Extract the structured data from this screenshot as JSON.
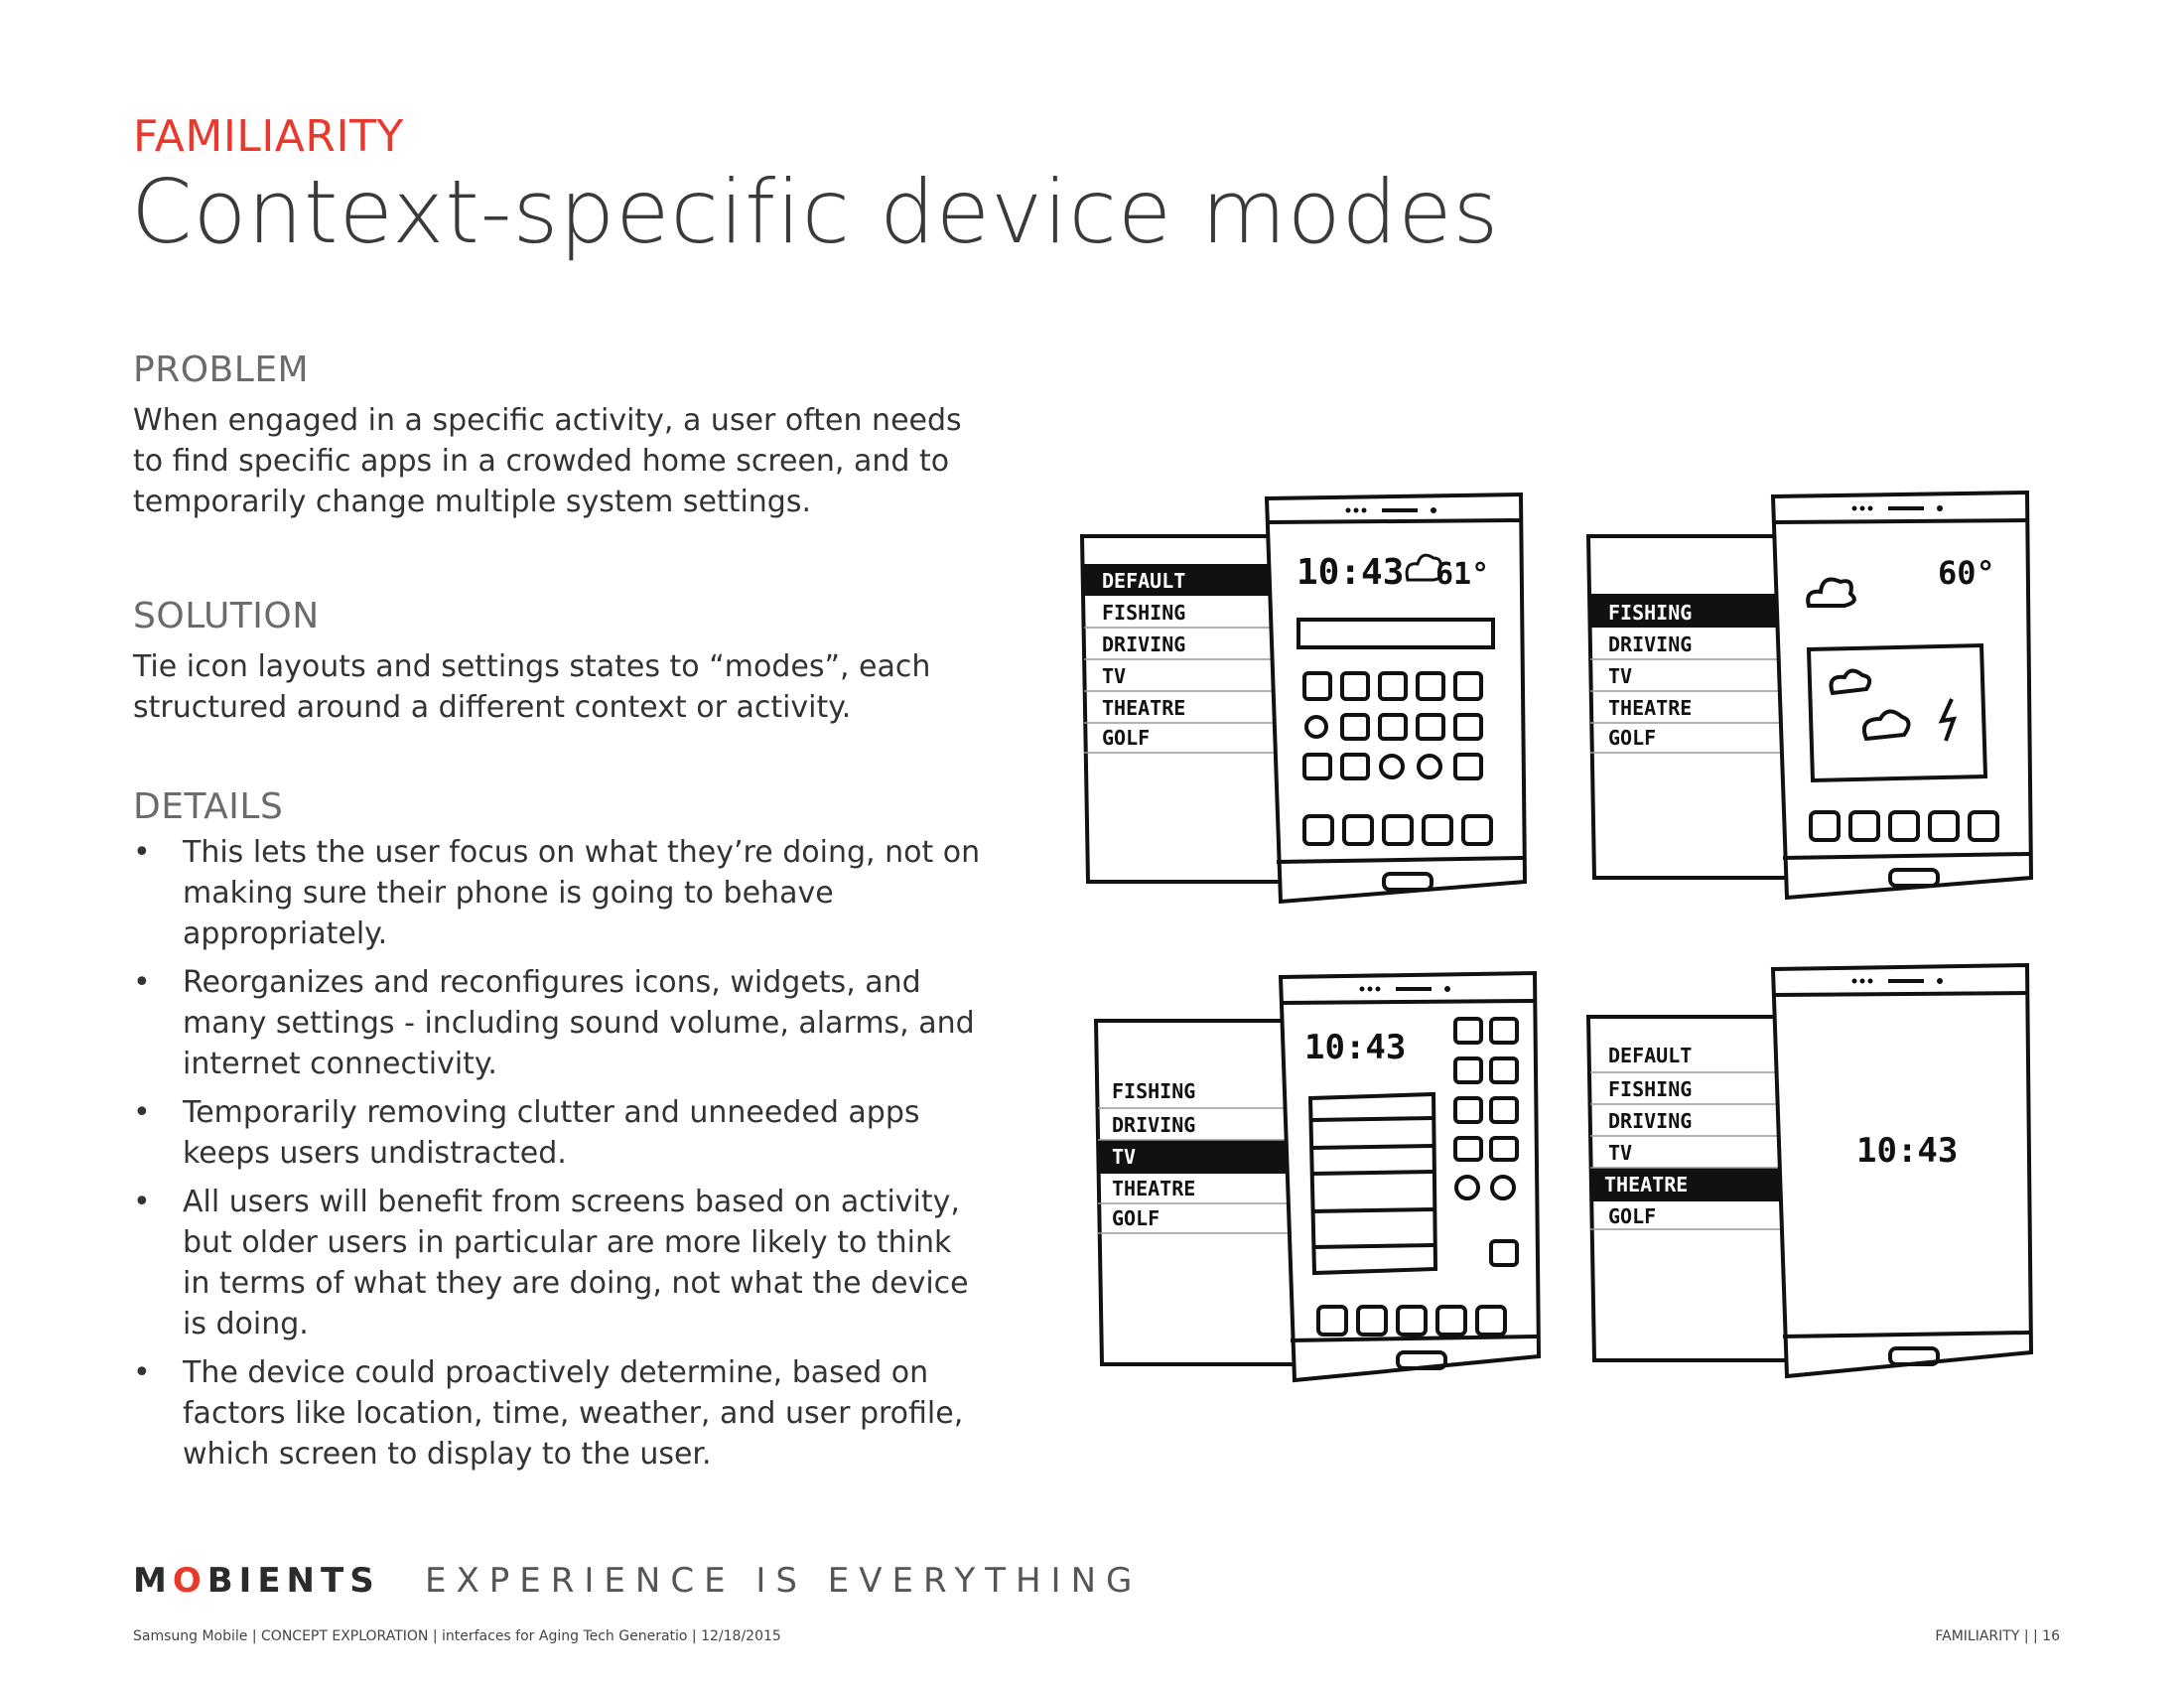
{
  "header": {
    "eyebrow": "FAMILIARITY",
    "title": "Context-specific device modes"
  },
  "problem": {
    "heading": "PROBLEM",
    "text": "When engaged in a specific activity, a user often needs to find specific apps in a crowded home screen, and to temporarily change multiple system settings."
  },
  "solution": {
    "heading": "SOLUTION",
    "text": "Tie icon layouts and settings states to “modes”, each structured around a different context or activity."
  },
  "details": {
    "heading": "DETAILS",
    "items": [
      "This lets the user focus on what they’re doing, not on making sure their phone is going to behave appropriately.",
      "Reorganizes and reconfigures icons, widgets, and many settings - including sound volume, alarms, and internet connectivity.",
      "Temporarily removing clutter and unneeded apps keeps users undistracted.",
      "All users will benefit from screens based on activity, but older users in particular are more likely to think in terms of what they are doing, not what the device is doing.",
      "The device could proactively determine, based on factors like location, time, weather, and user profile, which screen to display to the user."
    ]
  },
  "sketches": {
    "s1": {
      "menu": [
        "DEFAULT",
        "FISHING",
        "DRIVING",
        "TV",
        "THEATRE",
        "GOLF"
      ],
      "clock": "10:43",
      "temp": "61°"
    },
    "s2": {
      "menu": [
        "FISHING",
        "DRIVING",
        "TV",
        "THEATRE",
        "GOLF"
      ],
      "temp": "60°"
    },
    "s3": {
      "menu": [
        "FISHING",
        "DRIVING",
        "TV",
        "THEATRE",
        "GOLF"
      ],
      "clock": "10:43"
    },
    "s4": {
      "menu": [
        "DEFAULT",
        "FISHING",
        "DRIVING",
        "TV",
        "THEATRE",
        "GOLF"
      ],
      "clock": "10:43"
    }
  },
  "footer": {
    "logo_m": "M",
    "logo_o": "O",
    "logo_rest": "BIENTS",
    "tagline": "EXPERIENCE IS EVERYTHING",
    "left": "Samsung Mobile | CONCEPT EXPLORATION | interfaces for Aging Tech Generatio | 12/18/2015",
    "right": "FAMILIARITY  |   | 16"
  }
}
